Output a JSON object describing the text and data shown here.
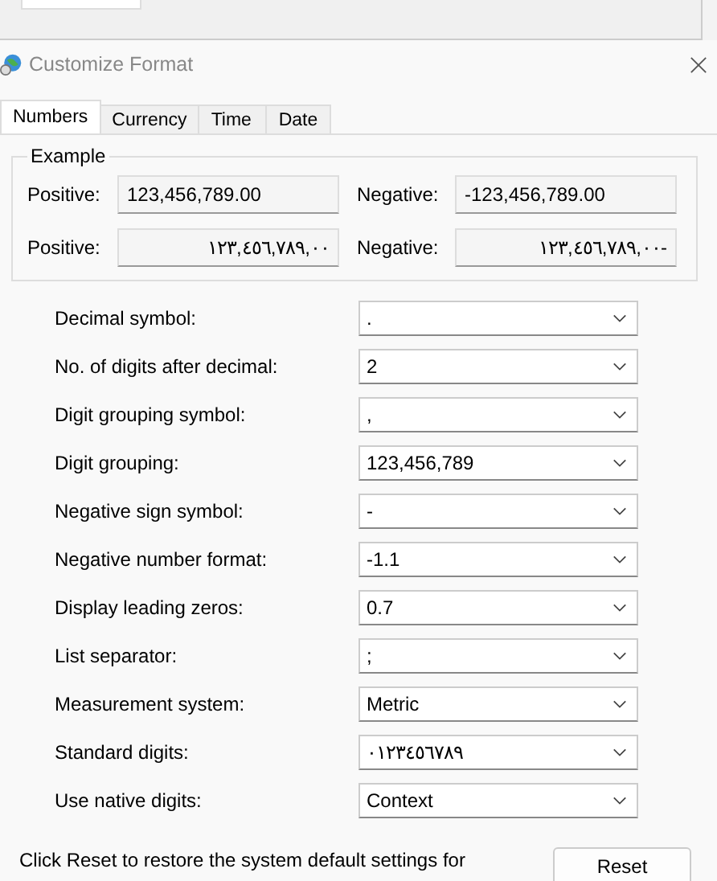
{
  "window": {
    "title": "Customize Format"
  },
  "tabs": [
    {
      "label": "Numbers",
      "selected": true
    },
    {
      "label": "Currency",
      "selected": false
    },
    {
      "label": "Time",
      "selected": false
    },
    {
      "label": "Date",
      "selected": false
    }
  ],
  "example": {
    "title": "Example",
    "rows": [
      {
        "positive_label": "Positive:",
        "positive": "123,456,789.00",
        "negative_label": "Negative:",
        "negative": "-123,456,789.00",
        "kind": "latin"
      },
      {
        "positive_label": "Positive:",
        "positive": "١٢٣,٤٥٦,٧٨٩,٠٠",
        "negative_label": "Negative:",
        "negative": "١٢٣,٤٥٦,٧٨٩,٠٠-",
        "kind": "native"
      }
    ]
  },
  "settings": [
    {
      "label": "Decimal symbol:",
      "value": "."
    },
    {
      "label": "No. of digits after decimal:",
      "value": "2"
    },
    {
      "label": "Digit grouping symbol:",
      "value": ","
    },
    {
      "label": "Digit grouping:",
      "value": "123,456,789"
    },
    {
      "label": "Negative sign symbol:",
      "value": "-"
    },
    {
      "label": "Negative number format:",
      "value": "-1.1"
    },
    {
      "label": "Display leading zeros:",
      "value": "0.7"
    },
    {
      "label": "List separator:",
      "value": ";"
    },
    {
      "label": "Measurement system:",
      "value": "Metric"
    },
    {
      "label": "Standard digits:",
      "value": "٠١٢٣٤٥٦٧٨٩"
    },
    {
      "label": "Use native digits:",
      "value": "Context"
    }
  ],
  "reset_note": "Click Reset to restore the system default settings for",
  "reset_button": "Reset"
}
